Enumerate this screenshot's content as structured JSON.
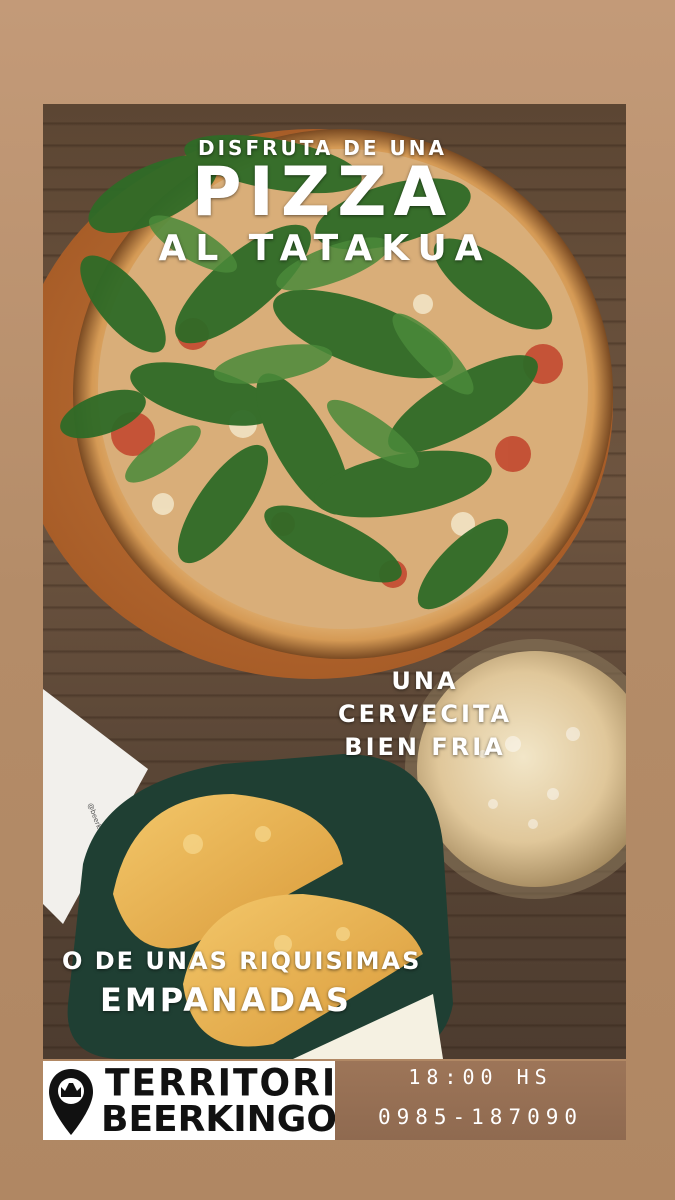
{
  "headline": {
    "intro": "DISFRUTA DE UNA",
    "main": "PIZZA",
    "sub": "AL TATAKUA"
  },
  "beer_text": [
    "UNA",
    "CERVECITA",
    "BIEN FRIA"
  ],
  "empanadas_text": {
    "line1": "O DE UNAS RIQUISIMAS",
    "line2": "EMPANADAS"
  },
  "napkin_text": "@beerkingo's",
  "footer": {
    "brand_line1": "TERRITORIO",
    "brand_line2": "BEERKINGO'S",
    "hours": "18:00 HS",
    "phone": "0985-187090"
  },
  "colors": {
    "background": "#c39a78",
    "text": "#ffffff",
    "footer_right": "#9d7558"
  }
}
